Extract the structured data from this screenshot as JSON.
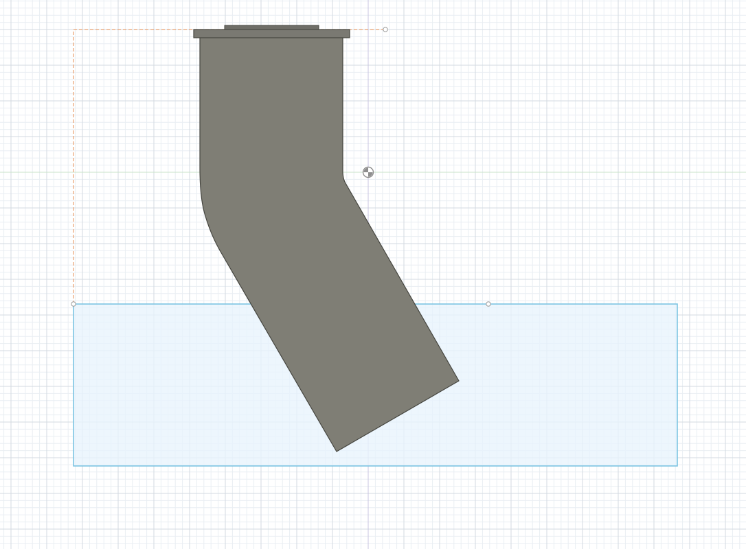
{
  "scene": {
    "background": "#ffffff",
    "colors": {
      "body": "#7f7e75",
      "body_edge": "#45453f",
      "sketch_plane_fill": "#e8f4fc",
      "sketch_plane_edge": "#7cc4e2",
      "dimension_line": "#e8a070",
      "grid_minor": "#e9eef3",
      "grid_major": "#d3dae1",
      "axis_x": "#c9e3c9",
      "axis_y": "#c8c4e0"
    },
    "icons": {
      "origin": "origin-icon",
      "handle": "drag-handle-icon"
    }
  }
}
